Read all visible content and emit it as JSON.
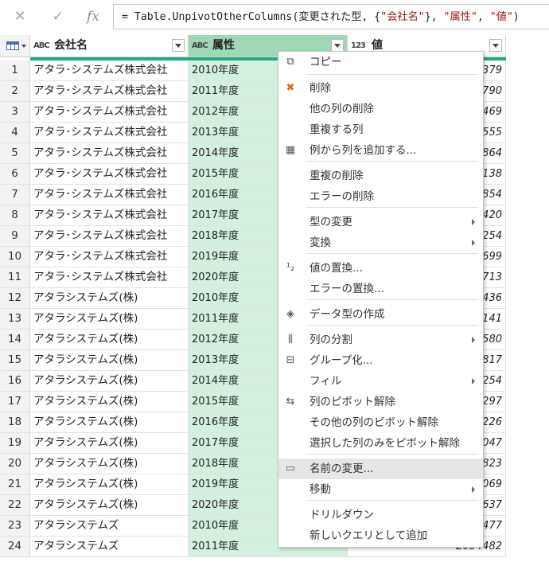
{
  "formula_bar": {
    "cancel_icon": "✕",
    "confirm_icon": "✓",
    "fx_label": "fx",
    "formula_prefix": "= Table.UnpivotOtherColumns(変更された型, {",
    "formula_str1": "\"会社名\"",
    "formula_mid": "}, ",
    "formula_str2": "\"属性\"",
    "formula_sep": ", ",
    "formula_str3": "\"値\"",
    "formula_suffix": ")"
  },
  "columns": [
    {
      "type_icon": "ABC",
      "label": "会社名"
    },
    {
      "type_icon": "ABC",
      "label": "属性"
    },
    {
      "type_icon": "123",
      "label": "値"
    }
  ],
  "colors": {
    "selected_header": "#9fd8b5",
    "selected_cells": "#d3f0df",
    "quality_bar": "#22aa88"
  },
  "rows": [
    {
      "n": "1",
      "company": "アタラ･システムズ株式会社",
      "attr": "2010年度",
      "value": "379"
    },
    {
      "n": "2",
      "company": "アタラ･システムズ株式会社",
      "attr": "2011年度",
      "value": "790"
    },
    {
      "n": "3",
      "company": "アタラ･システムズ株式会社",
      "attr": "2012年度",
      "value": "469"
    },
    {
      "n": "4",
      "company": "アタラ･システムズ株式会社",
      "attr": "2013年度",
      "value": "555"
    },
    {
      "n": "5",
      "company": "アタラ･システムズ株式会社",
      "attr": "2014年度",
      "value": "864"
    },
    {
      "n": "6",
      "company": "アタラ･システムズ株式会社",
      "attr": "2015年度",
      "value": "138"
    },
    {
      "n": "7",
      "company": "アタラ･システムズ株式会社",
      "attr": "2016年度",
      "value": "854"
    },
    {
      "n": "8",
      "company": "アタラ･システムズ株式会社",
      "attr": "2017年度",
      "value": "420"
    },
    {
      "n": "9",
      "company": "アタラ･システムズ株式会社",
      "attr": "2018年度",
      "value": "254"
    },
    {
      "n": "10",
      "company": "アタラ･システムズ株式会社",
      "attr": "2019年度",
      "value": "699"
    },
    {
      "n": "11",
      "company": "アタラ･システムズ株式会社",
      "attr": "2020年度",
      "value": "713"
    },
    {
      "n": "12",
      "company": "アタラシステムズ(株)",
      "attr": "2010年度",
      "value": "436"
    },
    {
      "n": "13",
      "company": "アタラシステムズ(株)",
      "attr": "2011年度",
      "value": "141"
    },
    {
      "n": "14",
      "company": "アタラシステムズ(株)",
      "attr": "2012年度",
      "value": "580"
    },
    {
      "n": "15",
      "company": "アタラシステムズ(株)",
      "attr": "2013年度",
      "value": "817"
    },
    {
      "n": "16",
      "company": "アタラシステムズ(株)",
      "attr": "2014年度",
      "value": "254"
    },
    {
      "n": "17",
      "company": "アタラシステムズ(株)",
      "attr": "2015年度",
      "value": "297"
    },
    {
      "n": "18",
      "company": "アタラシステムズ(株)",
      "attr": "2016年度",
      "value": "226"
    },
    {
      "n": "19",
      "company": "アタラシステムズ(株)",
      "attr": "2017年度",
      "value": "047"
    },
    {
      "n": "20",
      "company": "アタラシステムズ(株)",
      "attr": "2018年度",
      "value": "823"
    },
    {
      "n": "21",
      "company": "アタラシステムズ(株)",
      "attr": "2019年度",
      "value": "069"
    },
    {
      "n": "22",
      "company": "アタラシステムズ(株)",
      "attr": "2020年度",
      "value": "637"
    },
    {
      "n": "23",
      "company": "アタラシステムズ",
      "attr": "2010年度",
      "value": "477"
    },
    {
      "n": "24",
      "company": "アタラシステムズ",
      "attr": "2011年度",
      "value": "2054482"
    }
  ],
  "context_menu": {
    "items": [
      {
        "label": "コピー",
        "icon": "copy-icon",
        "top": 0
      },
      {
        "label": "削除",
        "icon": "delete-column-icon"
      },
      {
        "label": "他の列の削除",
        "icon": ""
      },
      {
        "label": "重複する列",
        "icon": ""
      },
      {
        "label": "例から列を追加する...",
        "icon": "column-from-examples-icon"
      },
      {
        "label": "重複の削除",
        "icon": ""
      },
      {
        "label": "エラーの削除",
        "icon": ""
      },
      {
        "label": "型の変更",
        "icon": "",
        "submenu": true
      },
      {
        "label": "変換",
        "icon": "",
        "submenu": true
      },
      {
        "label": "値の置換...",
        "icon": "replace-values-icon"
      },
      {
        "label": "エラーの置換...",
        "icon": ""
      },
      {
        "label": "データ型の作成",
        "icon": "data-type-icon"
      },
      {
        "label": "列の分割",
        "icon": "split-column-icon",
        "submenu": true
      },
      {
        "label": "グループ化...",
        "icon": "group-by-icon"
      },
      {
        "label": "フィル",
        "icon": "",
        "submenu": true
      },
      {
        "label": "列のピボット解除",
        "icon": "unpivot-icon"
      },
      {
        "label": "その他の列のピボット解除",
        "icon": ""
      },
      {
        "label": "選択した列のみをピボット解除",
        "icon": ""
      },
      {
        "label": "名前の変更...",
        "icon": "rename-icon",
        "hover": true
      },
      {
        "label": "移動",
        "icon": "",
        "submenu": true
      },
      {
        "label": "ドリルダウン",
        "icon": ""
      },
      {
        "label": "新しいクエリとして追加",
        "icon": ""
      }
    ]
  }
}
